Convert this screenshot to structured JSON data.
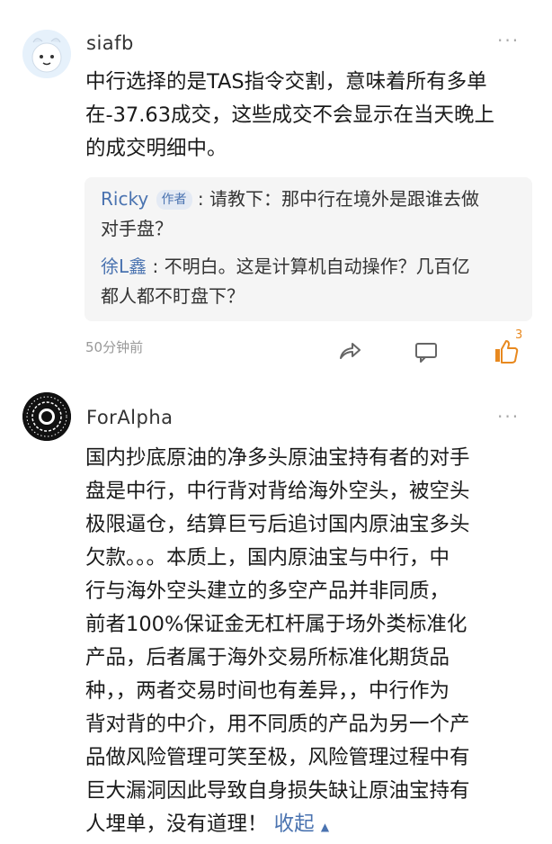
{
  "comments": [
    {
      "username": "siafb",
      "text_lines": [
        "中行选择的是TAS指令交割，意味着所有多单",
        "在-37.63成交，这些成交不会显示在当天晚上",
        "的成交明细中。"
      ],
      "replies": [
        {
          "name": "Ricky",
          "badge": "作者",
          "text_lines": [
            ": 请教下：那中行在境外是跟谁去做",
            "对手盘？"
          ]
        },
        {
          "name": "徐L鑫",
          "text_lines": [
            ": 不明白。这是计算机自动操作？几百亿",
            "都人都不盯盘下？"
          ]
        }
      ],
      "time": "50分钟前",
      "like_count": "3"
    },
    {
      "username": "ForAlpha",
      "text_lines": [
        "国内抄底原油的净多头原油宝持有者的对手",
        "盘是中行，中行背对背给海外空头，被空头",
        "极限逼仓，结算巨亏后追讨国内原油宝多头",
        "欠款。。。本质上，国内原油宝与中行，中",
        "行与海外空头建立的多空产品并非同质，",
        "前者100%保证金无杠杆属于场外类标准化",
        "产品，后者属于海外交易所标准化期货品",
        "种，，两者交易时间也有差异，，中行作为",
        "背对背的中介，用不同质的产品为另一个产",
        "品做风险管理可笑至极，风险管理过程中有",
        "巨大漏洞因此导致自身损失缺让原油宝持有",
        "人埋单，没有道理！"
      ],
      "collapse_label": "收起",
      "collapse_arrow": "▲"
    }
  ],
  "icons": {
    "more": "···",
    "share": "share-icon",
    "reply": "comment-icon",
    "like": "thumbs-up-icon"
  },
  "colors": {
    "link": "#4a73b0",
    "like": "#e8891f",
    "reply_bg": "#f5f5f5"
  }
}
